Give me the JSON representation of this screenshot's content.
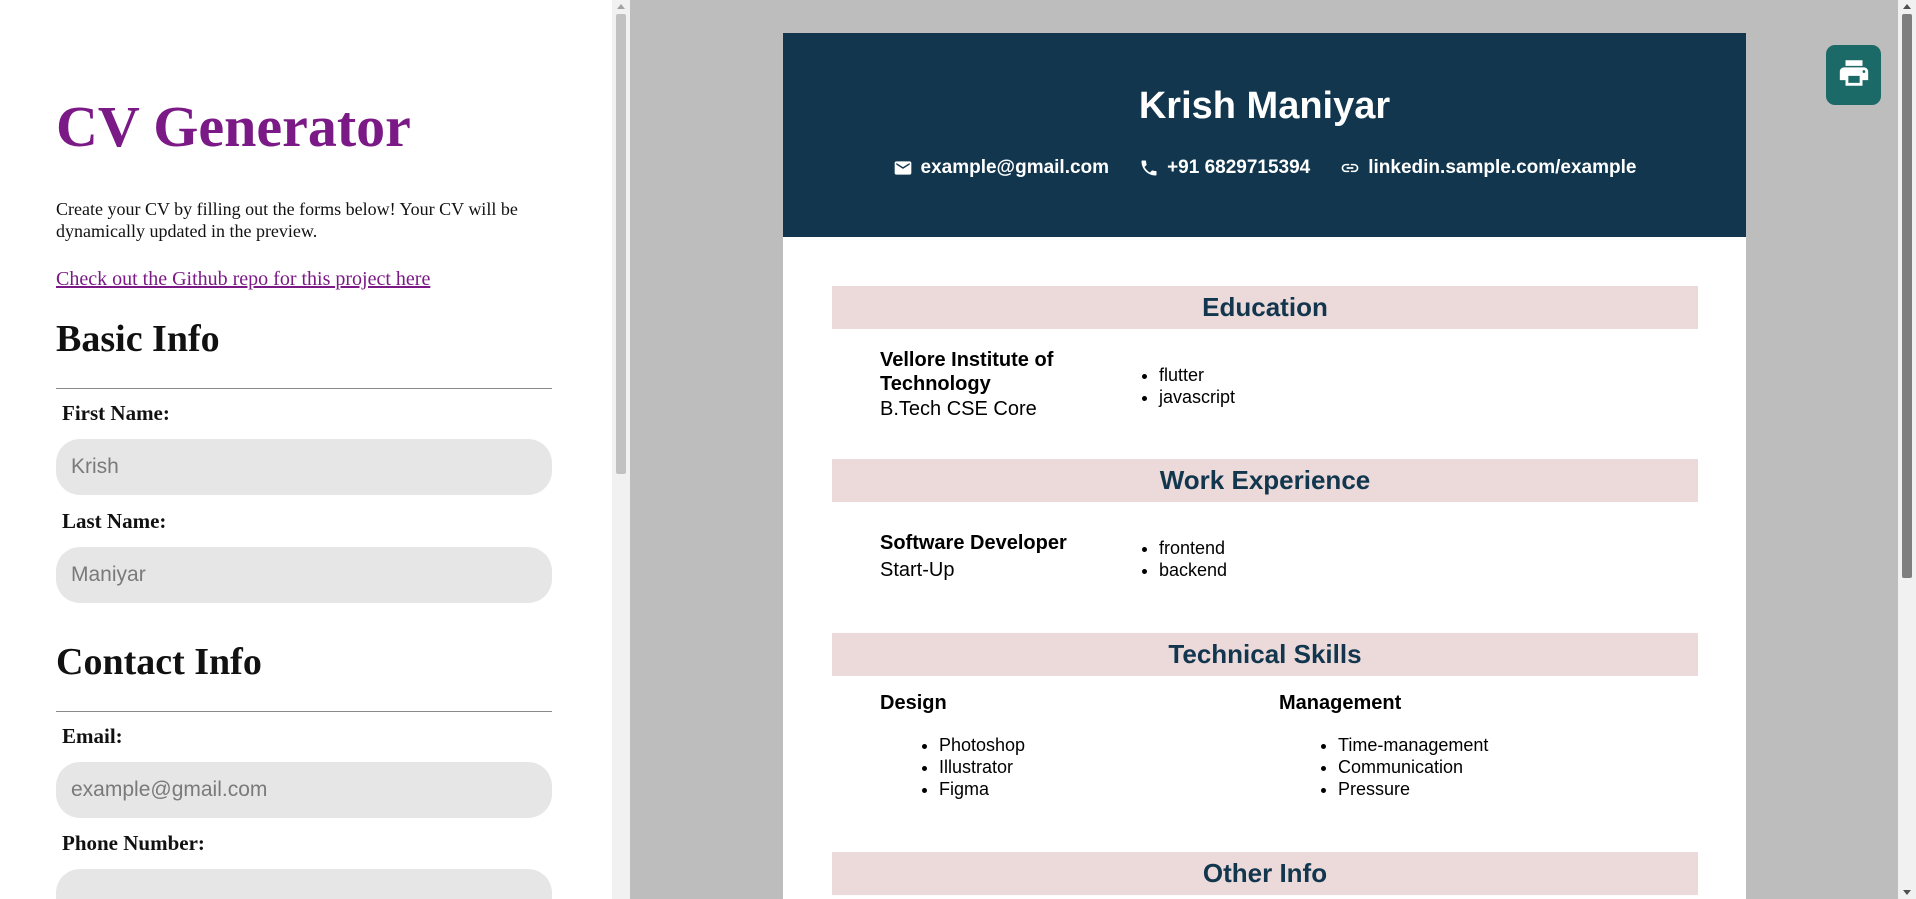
{
  "app": {
    "title": "CV Generator",
    "description": "Create your CV by filling out the forms below! Your CV will be dynamically updated in the preview.",
    "repo_link": "Check out the Github repo for this project here"
  },
  "form": {
    "basic_info": {
      "heading": "Basic Info",
      "first_name_label": "First Name:",
      "first_name_placeholder": "Krish",
      "last_name_label": "Last Name:",
      "last_name_placeholder": "Maniyar"
    },
    "contact_info": {
      "heading": "Contact Info",
      "email_label": "Email:",
      "email_placeholder": "example@gmail.com",
      "phone_label": "Phone Number:",
      "phone_placeholder": ""
    }
  },
  "cv": {
    "name": "Krish Maniyar",
    "contacts": [
      {
        "icon": "mail-icon",
        "text": "example@gmail.com"
      },
      {
        "icon": "phone-icon",
        "text": "+91 6829715394"
      },
      {
        "icon": "link-icon",
        "text": "linkedin.sample.com/example"
      }
    ],
    "education": {
      "heading": "Education",
      "institution": "Vellore Institute of Technology",
      "degree": "B.Tech CSE Core",
      "items": [
        "flutter",
        "javascript"
      ]
    },
    "work": {
      "heading": "Work Experience",
      "role": "Software Developer",
      "company": "Start-Up",
      "items": [
        "frontend",
        "backend"
      ]
    },
    "skills": {
      "heading": "Technical Skills",
      "groups": [
        {
          "name": "Design",
          "items": [
            "Photoshop",
            "Illustrator",
            "Figma"
          ]
        },
        {
          "name": "Management",
          "items": [
            "Time-management",
            "Communication",
            "Pressure"
          ]
        }
      ]
    },
    "other": {
      "heading": "Other Info"
    }
  },
  "colors": {
    "title_purple": "#7b1a86",
    "header_navy": "#11364d",
    "section_pink": "#ecdada",
    "print_teal": "#1c6a67",
    "preview_gray": "#bdbdbd"
  }
}
